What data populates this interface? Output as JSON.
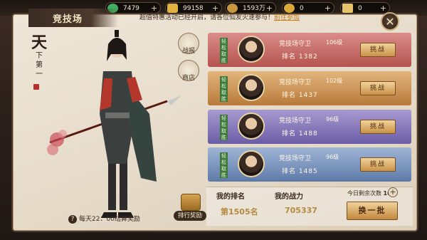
{
  "resources": [
    {
      "icon": "jade-icon",
      "value": "7479",
      "color": "#3fae5f"
    },
    {
      "icon": "gold-ingot-icon",
      "value": "99158",
      "color": "#e0b040"
    },
    {
      "icon": "copper-coin-icon",
      "value": "1593万",
      "color": "#c99640"
    },
    {
      "icon": "gold-coin-icon",
      "value": "0",
      "color": "#d9a93a"
    },
    {
      "icon": "scroll-token-icon",
      "value": "0",
      "color": "#e6c26a"
    }
  ],
  "header": {
    "title": "竞技场",
    "notice": "超值特惠活动已经开启，请各位仙友火速参与！",
    "notice_link": "前往参加"
  },
  "banner": {
    "big1": "天",
    "small": [
      "下",
      "第",
      "一"
    ]
  },
  "side_buttons": [
    {
      "label": "战报",
      "icon": "battle-report-icon"
    },
    {
      "label": "商店",
      "icon": "shop-icon"
    }
  ],
  "footer": {
    "settle_text": "每天22：00结算奖励",
    "rank_reward_label": "排行奖励"
  },
  "opponents": [
    {
      "tag": "轻松取胜",
      "name": "竞技场守卫",
      "level": "106级",
      "rank": "排名 1382",
      "button": "挑战",
      "color_top": "#d98d8a",
      "color_bot": "#b5534f"
    },
    {
      "tag": "轻松取胜",
      "name": "竞技场守卫",
      "level": "102级",
      "rank": "排名 1437",
      "button": "挑战",
      "color_top": "#e2b57d",
      "color_bot": "#b87a3b"
    },
    {
      "tag": "轻松取胜",
      "name": "竞技场守卫",
      "level": "96级",
      "rank": "排名 1488",
      "button": "挑战",
      "color_top": "#a79ad0",
      "color_bot": "#6b5da6"
    },
    {
      "tag": "轻松取胜",
      "name": "竞技场守卫",
      "level": "96级",
      "rank": "排名 1485",
      "button": "挑战",
      "color_top": "#9fb5d6",
      "color_bot": "#5d7aa8"
    }
  ],
  "stats": {
    "my_rank_label": "我的排名",
    "my_rank_value": "第1505名",
    "my_power_label": "我的战力",
    "my_power_value": "705337",
    "remaining_label": "今日剩余次数",
    "remaining_value": "10",
    "refresh_label": "换一批"
  }
}
